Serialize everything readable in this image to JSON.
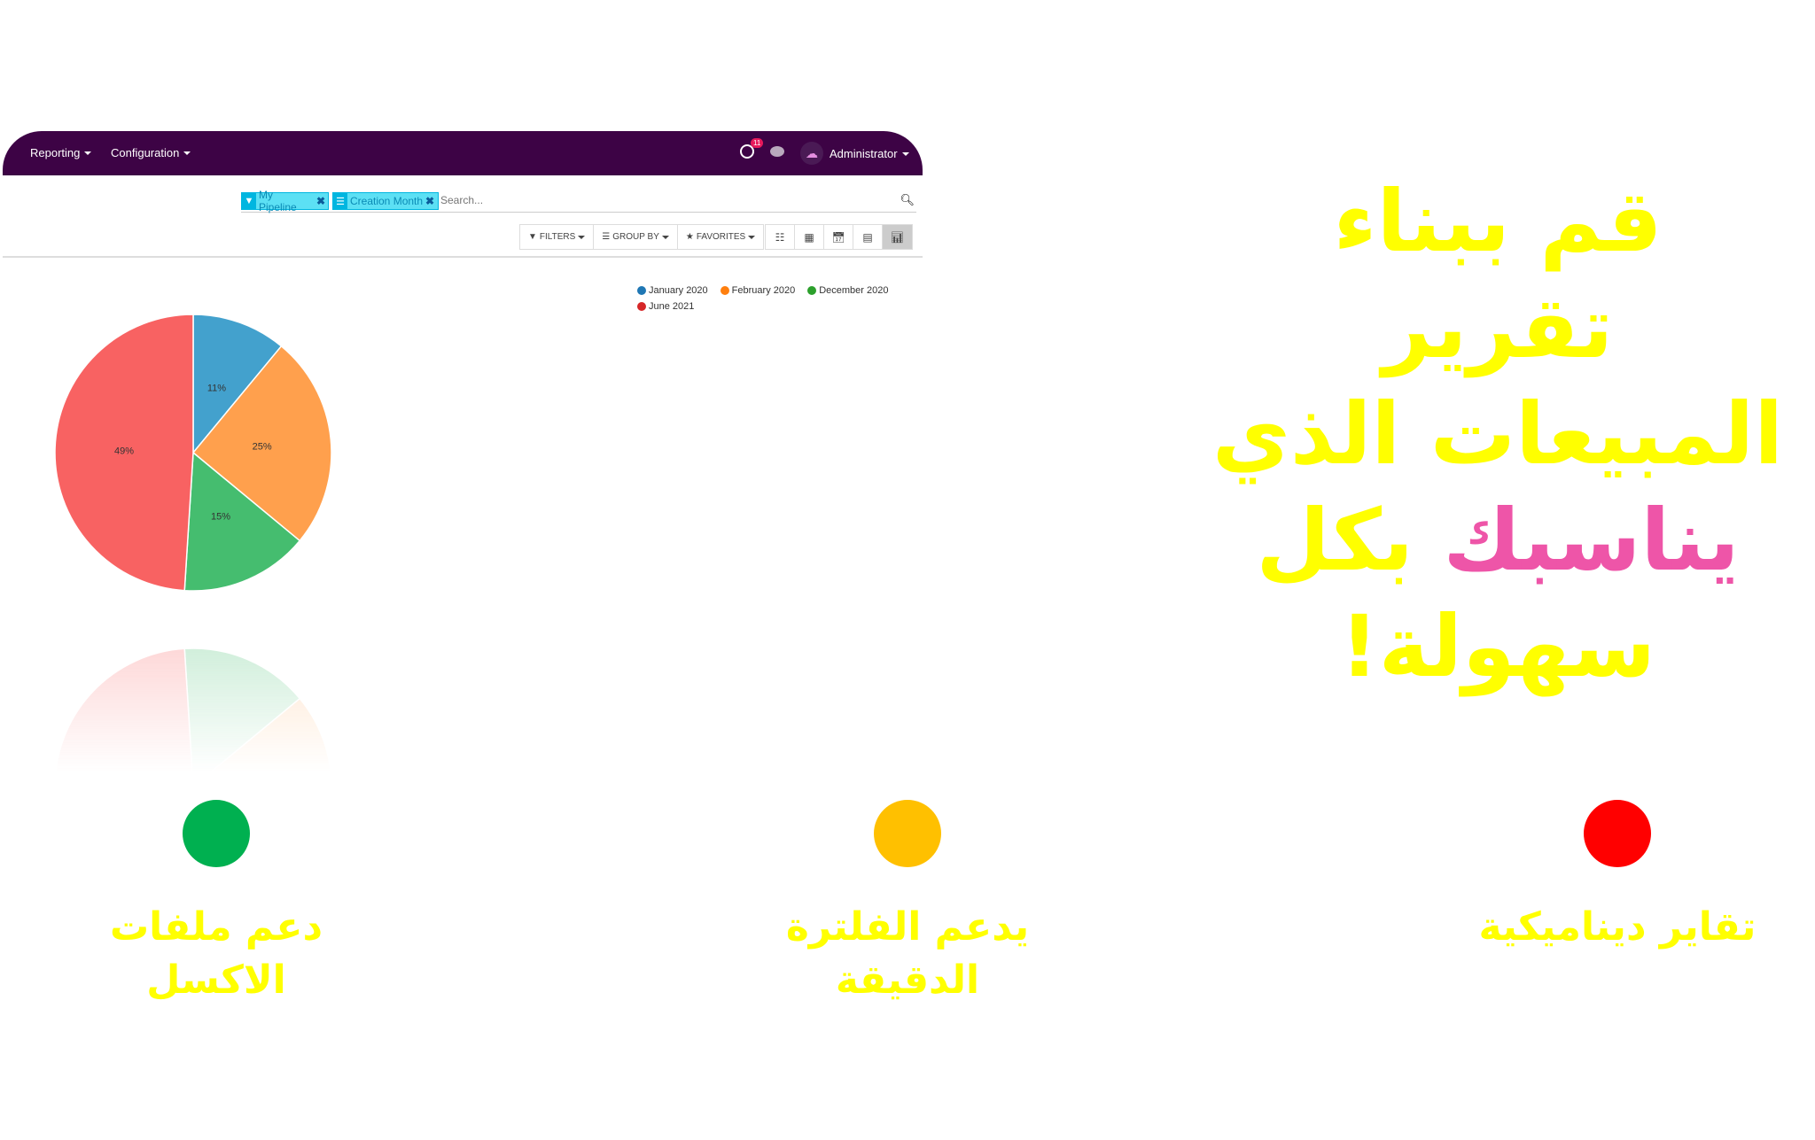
{
  "navbar": {
    "menus": [
      "Reporting",
      "Configuration"
    ],
    "notification_count": "11",
    "user": "Administrator",
    "bg_color": "#3d0345"
  },
  "search": {
    "facets": [
      {
        "icon": "filter-icon",
        "label": "My Pipeline"
      },
      {
        "icon": "group-icon",
        "label": "Creation Month"
      }
    ],
    "placeholder": "Search..."
  },
  "toolbar": {
    "filters": "FILTERS",
    "group_by": "GROUP BY",
    "favorites": "FAVORITES",
    "views": [
      "list-view",
      "kanban-view",
      "calendar-view",
      "pivot-view",
      "graph-view"
    ],
    "active_view": "graph-view"
  },
  "chart_data": {
    "type": "pie",
    "categories": [
      "January 2020",
      "February 2020",
      "December 2020",
      "June 2021"
    ],
    "values": [
      11,
      25,
      15,
      49
    ],
    "labels": [
      "11%",
      "25%",
      "15%",
      "49%"
    ],
    "colors": [
      "#43a1cd",
      "#ffa04d",
      "#45bd6f",
      "#f86262"
    ],
    "legend_colors": [
      "#1f77b4",
      "#ff7f0e",
      "#2ca02c",
      "#d62728"
    ],
    "legend_position": "top-right"
  },
  "headline": {
    "line1": "قم ببناء تقرير",
    "line2": "المبيعات الذي",
    "line3_highlight": "يناسبك",
    "line3_rest": "بكل",
    "line4": "سهولة!"
  },
  "features": [
    {
      "color": "#00b050",
      "line1": "دعم ملفات",
      "line2": "الاكسل"
    },
    {
      "color": "#ffc000",
      "line1": "يدعم الفلترة",
      "line2": "الدقيقة"
    },
    {
      "color": "#ff0000",
      "line1": "تقاير ديناميكية",
      "line2": ""
    }
  ]
}
